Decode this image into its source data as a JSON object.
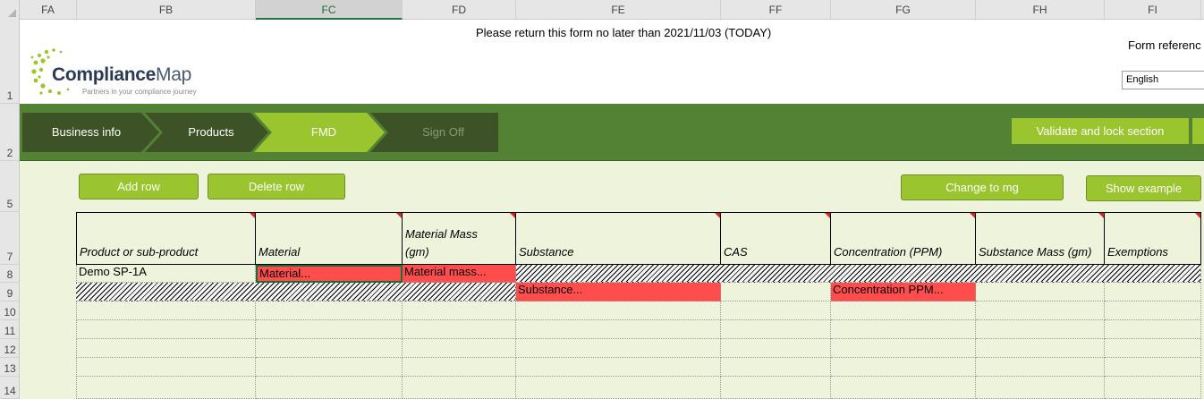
{
  "columns": [
    "FA",
    "FB",
    "FC",
    "FD",
    "FE",
    "FF",
    "FG",
    "FH",
    "FI"
  ],
  "rows": [
    "1",
    "2",
    "5",
    "7",
    "8",
    "9",
    "10",
    "11",
    "12",
    "13",
    "14"
  ],
  "logo": {
    "name_bold": "Compliance",
    "name_thin": "Map",
    "tagline": "Partners in your compliance journey"
  },
  "header": {
    "deadline": "Please return this form no later than  2021/11/03 (TODAY)",
    "form_reference": "Form referenc",
    "language": "English"
  },
  "steps": [
    {
      "label": "Business info"
    },
    {
      "label": "Products"
    },
    {
      "label": "FMD"
    },
    {
      "label": "Sign Off"
    }
  ],
  "actions": {
    "validate": "Validate and lock section",
    "add_row": "Add row",
    "delete_row": "Delete row",
    "change_mg": "Change to mg",
    "show_example": "Show example"
  },
  "table": {
    "headers": [
      "Product or sub-product",
      "Material",
      "Material Mass (gm)",
      "Substance",
      "CAS",
      "Concentration (PPM)",
      "Substance Mass (gm)",
      "Exemptions"
    ],
    "header_mass_line1": "Material Mass",
    "header_mass_line2": "(gm)",
    "row8": {
      "product": "Demo SP-1A",
      "material": "Material...",
      "material_mass": "Material mass..."
    },
    "row9": {
      "substance": "Substance...",
      "concentration": "Concentration PPM..."
    }
  },
  "colors": {
    "banner": "#548235",
    "accent": "#9bc52e",
    "required": "#ff4d4d",
    "body_bg": "#eef3dc"
  }
}
